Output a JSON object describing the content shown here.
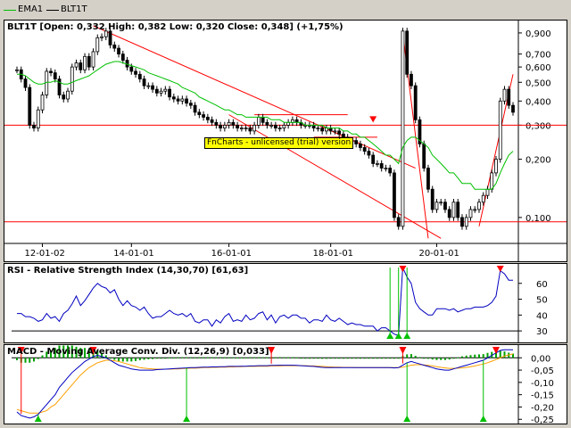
{
  "legend": {
    "series": [
      {
        "name": "EMA1",
        "color": "#00c000"
      },
      {
        "name": "BLT1T",
        "color": "#000000"
      }
    ]
  },
  "main": {
    "title": "BLT1T [Open: 0,332  High: 0,382  Low: 0,320  Close: 0,348] (+1,75%)",
    "watermark": "FnCharts - unlicensed (trial) version",
    "y_ticks": [
      "0,900",
      "0,700",
      "0,600",
      "0,500",
      "0,400",
      "0,300",
      "0,200",
      "0,100"
    ],
    "x_ticks": [
      "12-01-02",
      "14-01-01",
      "16-01-01",
      "18-01-01",
      "20-01-01"
    ]
  },
  "rsi": {
    "title": "RSI - Relative Strength Index (14,30,70) [61,63]",
    "y_ticks": [
      "60",
      "50",
      "40",
      "30"
    ]
  },
  "macd": {
    "title": "MACD - Moving Average Conv. Div. (12,26,9) [0,033]",
    "y_ticks": [
      "0,00",
      "-0,05",
      "-0,10",
      "-0,15",
      "-0,20",
      "-0,25"
    ]
  },
  "colors": {
    "ema": "#00c000",
    "candle": "#000000",
    "trendline": "#ff0000",
    "rsi_line": "#0000c0",
    "macd_line": "#0000c0",
    "signal_line": "#ffa000",
    "histogram": "#00a000",
    "watermark_bg": "#ffff00",
    "buy_marker": "#00c000",
    "sell_marker": "#ff0000"
  },
  "chart_data": [
    {
      "type": "candlestick",
      "title": "BLT1T [Open: 0,332  High: 0,382  Low: 0,320  Close: 0,348] (+1,75%)",
      "y_scale": "log",
      "ylim": [
        0.075,
        1.0
      ],
      "x_ticks": [
        "12-01-02",
        "14-01-01",
        "16-01-01",
        "18-01-01",
        "20-01-01"
      ],
      "series": [
        {
          "name": "BLT1T",
          "values": [
            0.58,
            0.52,
            0.47,
            0.3,
            0.29,
            0.36,
            0.43,
            0.57,
            0.56,
            0.52,
            0.43,
            0.41,
            0.45,
            0.6,
            0.63,
            0.58,
            0.68,
            0.6,
            0.72,
            0.85,
            0.86,
            0.92,
            0.78,
            0.75,
            0.7,
            0.65,
            0.6,
            0.57,
            0.55,
            0.52,
            0.48,
            0.48,
            0.46,
            0.44,
            0.45,
            0.46,
            0.42,
            0.41,
            0.4,
            0.41,
            0.39,
            0.38,
            0.35,
            0.34,
            0.33,
            0.32,
            0.31,
            0.3,
            0.29,
            0.3,
            0.31,
            0.3,
            0.29,
            0.29,
            0.29,
            0.28,
            0.3,
            0.33,
            0.31,
            0.3,
            0.3,
            0.29,
            0.29,
            0.3,
            0.31,
            0.32,
            0.31,
            0.3,
            0.3,
            0.3,
            0.29,
            0.29,
            0.28,
            0.29,
            0.28,
            0.28,
            0.27,
            0.26,
            0.25,
            0.25,
            0.24,
            0.23,
            0.22,
            0.21,
            0.19,
            0.19,
            0.18,
            0.18,
            0.17,
            0.1,
            0.09,
            0.92,
            0.55,
            0.48,
            0.32,
            0.24,
            0.18,
            0.14,
            0.11,
            0.12,
            0.12,
            0.11,
            0.1,
            0.12,
            0.1,
            0.09,
            0.1,
            0.11,
            0.11,
            0.12,
            0.13,
            0.14,
            0.17,
            0.2,
            0.4,
            0.46,
            0.38,
            0.35
          ]
        },
        {
          "name": "EMA1",
          "values": [
            0.55,
            0.55,
            0.54,
            0.52,
            0.5,
            0.49,
            0.49,
            0.5,
            0.5,
            0.51,
            0.5,
            0.49,
            0.49,
            0.5,
            0.51,
            0.52,
            0.53,
            0.54,
            0.56,
            0.58,
            0.6,
            0.62,
            0.63,
            0.64,
            0.64,
            0.63,
            0.62,
            0.61,
            0.6,
            0.59,
            0.58,
            0.56,
            0.55,
            0.54,
            0.53,
            0.52,
            0.51,
            0.5,
            0.49,
            0.47,
            0.46,
            0.45,
            0.44,
            0.42,
            0.41,
            0.4,
            0.39,
            0.38,
            0.37,
            0.36,
            0.36,
            0.35,
            0.34,
            0.34,
            0.33,
            0.33,
            0.33,
            0.33,
            0.33,
            0.33,
            0.32,
            0.32,
            0.32,
            0.31,
            0.31,
            0.31,
            0.31,
            0.31,
            0.3,
            0.3,
            0.3,
            0.3,
            0.3,
            0.29,
            0.29,
            0.29,
            0.29,
            0.28,
            0.28,
            0.27,
            0.27,
            0.26,
            0.26,
            0.25,
            0.24,
            0.23,
            0.22,
            0.21,
            0.21,
            0.2,
            0.19,
            0.23,
            0.25,
            0.26,
            0.26,
            0.25,
            0.24,
            0.23,
            0.21,
            0.2,
            0.19,
            0.18,
            0.17,
            0.17,
            0.16,
            0.15,
            0.15,
            0.15,
            0.14,
            0.14,
            0.14,
            0.14,
            0.14,
            0.15,
            0.17,
            0.19,
            0.21,
            0.22
          ]
        }
      ]
    },
    {
      "type": "line",
      "title": "RSI - Relative Strength Index (14,30,70) [61,63]",
      "ylim": [
        25,
        70
      ],
      "reference_levels": [
        30,
        70
      ],
      "series": [
        {
          "name": "RSI",
          "values": [
            41,
            41,
            39,
            39,
            38,
            36,
            37,
            41,
            38,
            39,
            36,
            41,
            43,
            47,
            52,
            46,
            49,
            53,
            57,
            60,
            58,
            57,
            54,
            56,
            50,
            46,
            49,
            46,
            45,
            43,
            45,
            41,
            38,
            39,
            39,
            41,
            43,
            41,
            40,
            41,
            39,
            41,
            36,
            35,
            37,
            37,
            33,
            37,
            35,
            39,
            41,
            36,
            37,
            36,
            40,
            37,
            38,
            41,
            42,
            37,
            40,
            35,
            39,
            40,
            38,
            40,
            40,
            38,
            38,
            35,
            37,
            37,
            36,
            40,
            37,
            36,
            38,
            36,
            34,
            35,
            34,
            34,
            33,
            33,
            33,
            30,
            32,
            32,
            30,
            28,
            27,
            70,
            64,
            60,
            48,
            44,
            42,
            40,
            40,
            44,
            44,
            44,
            43,
            44,
            42,
            43,
            44,
            44,
            45,
            45,
            45,
            46,
            48,
            52,
            68,
            66,
            62,
            62
          ]
        }
      ]
    },
    {
      "type": "line",
      "title": "MACD - Moving Average Conv. Div. (12,26,9) [0,033]",
      "ylim": [
        -0.26,
        0.03
      ],
      "series": [
        {
          "name": "MACD",
          "values": [
            -0.22,
            -0.235,
            -0.24,
            -0.245,
            -0.24,
            -0.23,
            -0.21,
            -0.19,
            -0.17,
            -0.15,
            -0.12,
            -0.1,
            -0.08,
            -0.06,
            -0.045,
            -0.03,
            -0.015,
            -0.005,
            0.005,
            0.01,
            0.005,
            0.0,
            -0.01,
            -0.02,
            -0.03,
            -0.035,
            -0.04,
            -0.045,
            -0.048,
            -0.05,
            -0.05,
            -0.05,
            -0.05,
            -0.048,
            -0.047,
            -0.046,
            -0.045,
            -0.044,
            -0.043,
            -0.042,
            -0.041,
            -0.04,
            -0.04,
            -0.039,
            -0.038,
            -0.038,
            -0.037,
            -0.037,
            -0.036,
            -0.036,
            -0.035,
            -0.035,
            -0.035,
            -0.034,
            -0.034,
            -0.033,
            -0.033,
            -0.032,
            -0.032,
            -0.032,
            -0.031,
            -0.031,
            -0.03,
            -0.03,
            -0.03,
            -0.03,
            -0.031,
            -0.032,
            -0.033,
            -0.034,
            -0.035,
            -0.037,
            -0.039,
            -0.04,
            -0.04,
            -0.04,
            -0.04,
            -0.04,
            -0.04,
            -0.04,
            -0.04,
            -0.04,
            -0.04,
            -0.04,
            -0.04,
            -0.04,
            -0.04,
            -0.04,
            -0.04,
            -0.041,
            -0.04,
            -0.03,
            -0.02,
            -0.015,
            -0.02,
            -0.025,
            -0.03,
            -0.035,
            -0.04,
            -0.045,
            -0.048,
            -0.05,
            -0.05,
            -0.045,
            -0.04,
            -0.035,
            -0.03,
            -0.025,
            -0.02,
            -0.015,
            -0.01,
            0.0,
            0.01,
            0.02,
            0.03,
            0.033,
            0.033,
            0.033
          ]
        },
        {
          "name": "Signal",
          "values": [
            -0.21,
            -0.215,
            -0.22,
            -0.225,
            -0.225,
            -0.225,
            -0.22,
            -0.215,
            -0.2,
            -0.19,
            -0.17,
            -0.15,
            -0.13,
            -0.11,
            -0.09,
            -0.07,
            -0.055,
            -0.04,
            -0.03,
            -0.02,
            -0.015,
            -0.01,
            -0.01,
            -0.012,
            -0.015,
            -0.02,
            -0.025,
            -0.03,
            -0.035,
            -0.04,
            -0.042,
            -0.044,
            -0.045,
            -0.046,
            -0.046,
            -0.046,
            -0.046,
            -0.045,
            -0.045,
            -0.044,
            -0.043,
            -0.042,
            -0.042,
            -0.041,
            -0.04,
            -0.04,
            -0.039,
            -0.039,
            -0.038,
            -0.038,
            -0.037,
            -0.037,
            -0.036,
            -0.036,
            -0.035,
            -0.035,
            -0.035,
            -0.034,
            -0.034,
            -0.034,
            -0.033,
            -0.033,
            -0.033,
            -0.032,
            -0.032,
            -0.032,
            -0.032,
            -0.032,
            -0.032,
            -0.033,
            -0.033,
            -0.034,
            -0.035,
            -0.036,
            -0.037,
            -0.038,
            -0.038,
            -0.039,
            -0.039,
            -0.039,
            -0.04,
            -0.04,
            -0.04,
            -0.04,
            -0.04,
            -0.04,
            -0.04,
            -0.04,
            -0.04,
            -0.04,
            -0.04,
            -0.038,
            -0.034,
            -0.03,
            -0.028,
            -0.028,
            -0.029,
            -0.031,
            -0.033,
            -0.036,
            -0.039,
            -0.041,
            -0.043,
            -0.043,
            -0.042,
            -0.041,
            -0.039,
            -0.036,
            -0.033,
            -0.029,
            -0.025,
            -0.02,
            -0.014,
            -0.007,
            0.0,
            0.007,
            0.012,
            0.016
          ]
        }
      ]
    }
  ]
}
